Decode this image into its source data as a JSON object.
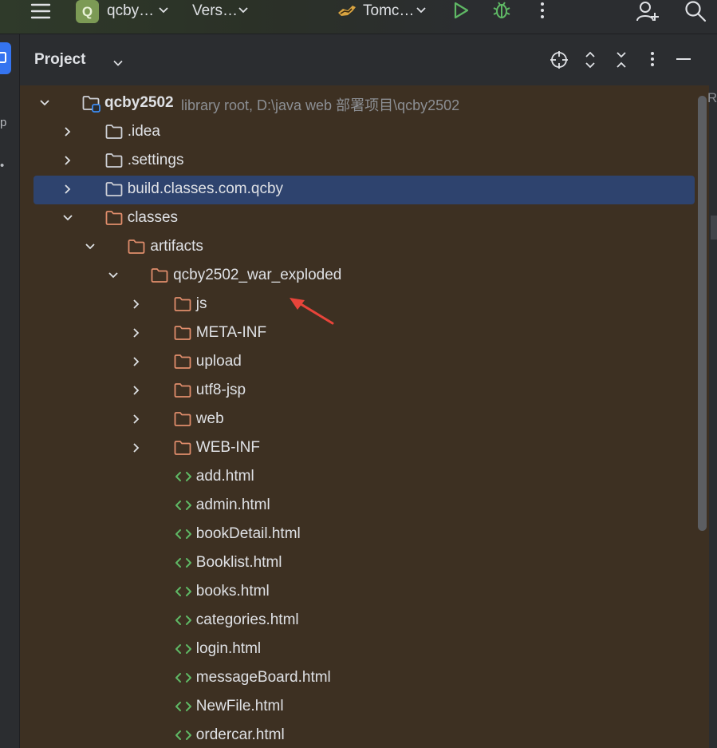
{
  "toolbar": {
    "project_badge": "Q",
    "project_name": "qcby…",
    "vcs_label": "Vers…",
    "run_config": "Tomc…"
  },
  "tool_window": {
    "title": "Project"
  },
  "tree": [
    {
      "depth": 0,
      "kind": "module",
      "expanded": true,
      "label": "qcby2502",
      "hint": "library root,  D:\\java web 部署项目\\qcby2502",
      "bold": true
    },
    {
      "depth": 1,
      "kind": "folder",
      "expanded": false,
      "label": ".idea"
    },
    {
      "depth": 1,
      "kind": "folder",
      "expanded": false,
      "label": ".settings"
    },
    {
      "depth": 1,
      "kind": "folder",
      "expanded": false,
      "label": "build.classes.com.qcby",
      "selected": true
    },
    {
      "depth": 1,
      "kind": "folder-excluded",
      "expanded": true,
      "label": "classes"
    },
    {
      "depth": 2,
      "kind": "folder-excluded",
      "expanded": true,
      "label": "artifacts"
    },
    {
      "depth": 3,
      "kind": "folder-excluded",
      "expanded": true,
      "label": "qcby2502_war_exploded"
    },
    {
      "depth": 4,
      "kind": "folder-excluded",
      "expanded": false,
      "label": "js"
    },
    {
      "depth": 4,
      "kind": "folder-excluded",
      "expanded": false,
      "label": "META-INF"
    },
    {
      "depth": 4,
      "kind": "folder-excluded",
      "expanded": false,
      "label": "upload"
    },
    {
      "depth": 4,
      "kind": "folder-excluded",
      "expanded": false,
      "label": "utf8-jsp"
    },
    {
      "depth": 4,
      "kind": "folder-excluded",
      "expanded": false,
      "label": "web"
    },
    {
      "depth": 4,
      "kind": "folder-excluded",
      "expanded": false,
      "label": "WEB-INF"
    },
    {
      "depth": 4,
      "kind": "html",
      "label": "add.html"
    },
    {
      "depth": 4,
      "kind": "html",
      "label": "admin.html"
    },
    {
      "depth": 4,
      "kind": "html",
      "label": "bookDetail.html"
    },
    {
      "depth": 4,
      "kind": "html",
      "label": "Booklist.html"
    },
    {
      "depth": 4,
      "kind": "html",
      "label": "books.html"
    },
    {
      "depth": 4,
      "kind": "html",
      "label": "categories.html"
    },
    {
      "depth": 4,
      "kind": "html",
      "label": "login.html"
    },
    {
      "depth": 4,
      "kind": "html",
      "label": "messageBoard.html"
    },
    {
      "depth": 4,
      "kind": "html",
      "label": "NewFile.html"
    },
    {
      "depth": 4,
      "kind": "html",
      "label": "ordercar.html"
    }
  ],
  "colors": {
    "tree_background": "#3d3022",
    "selection": "#2e436e",
    "folder_normal": "#ced0d6",
    "folder_excluded": "#e08d6c",
    "html_icon": "#5fb865",
    "annotation_arrow": "#e8443a"
  },
  "icons": {
    "toolbar": [
      "hamburger-menu-icon",
      "chevron-down-icon",
      "run-icon",
      "debug-bug-icon",
      "more-vertical-icon",
      "add-user-icon",
      "search-icon"
    ],
    "header": [
      "locate-target-icon",
      "expand-all-icon",
      "collapse-all-icon",
      "more-vertical-icon",
      "minimize-icon"
    ],
    "tree": [
      "folder-icon",
      "html-file-icon",
      "module-icon"
    ]
  }
}
